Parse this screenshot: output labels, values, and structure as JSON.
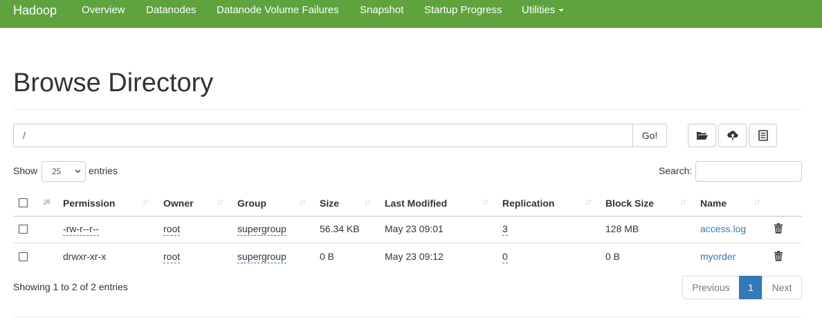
{
  "navbar": {
    "brand": "Hadoop",
    "items": [
      "Overview",
      "Datanodes",
      "Datanode Volume Failures",
      "Snapshot",
      "Startup Progress",
      "Utilities"
    ],
    "bg_color": "#5fa33e"
  },
  "page": {
    "title": "Browse Directory"
  },
  "path_bar": {
    "value": "/",
    "go_label": "Go!"
  },
  "toolbar": {
    "icons": [
      "folder-open-icon",
      "cloud-upload-icon",
      "list-alt-icon"
    ]
  },
  "table_controls": {
    "show_label": "Show",
    "entries_value": "25",
    "entries_label": "entries",
    "search_label": "Search:",
    "search_value": ""
  },
  "table": {
    "columns": [
      "Permission",
      "Owner",
      "Group",
      "Size",
      "Last Modified",
      "Replication",
      "Block Size",
      "Name"
    ],
    "rows": [
      {
        "permission": "-rw-r--r--",
        "owner": "root",
        "group": "supergroup",
        "size": "56.34 KB",
        "modified": "May 23 09:01",
        "replication": "3",
        "block_size": "128 MB",
        "name": "access.log"
      },
      {
        "permission": "drwxr-xr-x",
        "owner": "root",
        "group": "supergroup",
        "size": "0 B",
        "modified": "May 23 09:12",
        "replication": "0",
        "block_size": "0 B",
        "name": "myorder"
      }
    ]
  },
  "footer": {
    "info": "Showing 1 to 2 of 2 entries",
    "pagination": {
      "previous": "Previous",
      "current": "1",
      "next": "Next"
    }
  },
  "colors": {
    "link": "#337ab7",
    "active_page": "#337ab7"
  }
}
